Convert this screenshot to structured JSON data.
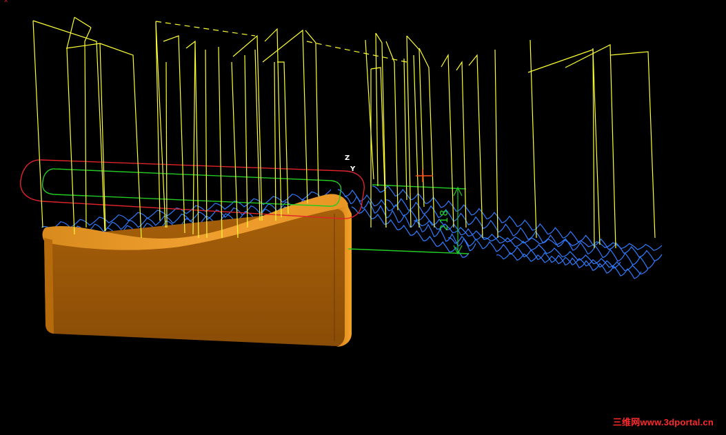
{
  "viewport": {
    "background": "#000000",
    "toolpath_color": "#ffff33",
    "link_path_color": "#2f7cff",
    "boundary_outer_color": "#e0242a",
    "boundary_inner_color": "#22cc22",
    "part_color": "#c87a12"
  },
  "axis_triad": {
    "z_label": "Z",
    "y_label": "Y"
  },
  "dimension_label": "218",
  "corner_mark": "x",
  "watermark": {
    "prefix": "三维网",
    "url": "www.3dportal.cn",
    "color": "#ff2a2a"
  }
}
